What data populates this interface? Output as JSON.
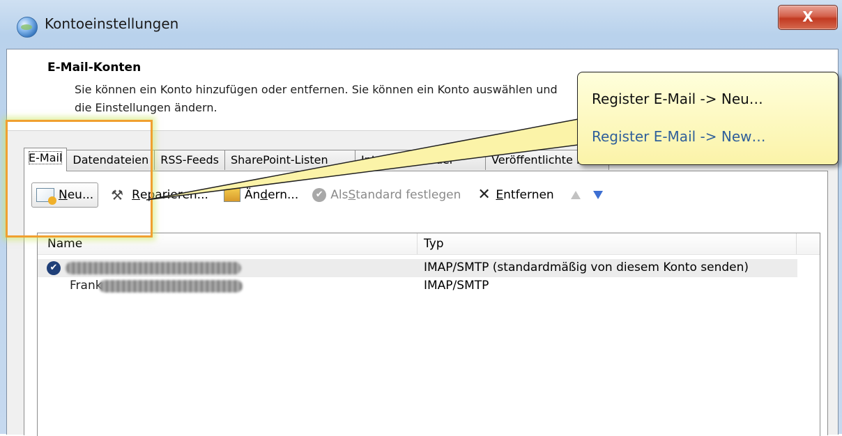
{
  "window": {
    "title": "Kontoeinstellungen",
    "close_glyph": "X"
  },
  "header": {
    "title": "E-Mail-Konten",
    "description": "Sie können ein Konto hinzufügen oder entfernen. Sie können ein Konto auswählen und die Einstellungen ändern."
  },
  "tabs": [
    {
      "label": "E-Mail",
      "active": true
    },
    {
      "label": "Datendateien"
    },
    {
      "label": "RSS-Feeds"
    },
    {
      "label": "SharePoint-Listen"
    },
    {
      "label": "Internetkalender"
    },
    {
      "label": "Veröffentlichte Kalender"
    }
  ],
  "toolbar": {
    "new": {
      "pre": "",
      "mnemonic": "N",
      "post": "eu...",
      "icon": "new-mail-icon"
    },
    "repair": {
      "pre": "",
      "mnemonic": "R",
      "post": "eparieren...",
      "icon": "tools-icon"
    },
    "change": {
      "pre": "Än",
      "mnemonic": "d",
      "post": "ern...",
      "icon": "change-account-icon"
    },
    "set_default": {
      "pre": "Als ",
      "mnemonic": "S",
      "post": "tandard festlegen",
      "icon": "check-circle-icon"
    },
    "remove": {
      "pre": "",
      "mnemonic": "E",
      "post": "ntfernen",
      "icon": "x-icon"
    },
    "move_up_icon": "arrow-up-icon",
    "move_down_icon": "arrow-down-icon"
  },
  "list": {
    "columns": {
      "name": "Name",
      "type": "Typ"
    },
    "rows": [
      {
        "name_visible": "",
        "type": "IMAP/SMTP (standardmäßig von diesem Konto senden)",
        "default": true
      },
      {
        "name_visible": "Frank",
        "type": "IMAP/SMTP",
        "default": false
      }
    ]
  },
  "callout": {
    "line_de": "Register E-Mail -> Neu…",
    "line_en": "Register E-Mail -> New…"
  },
  "colors": {
    "highlight_border": "#f0a030",
    "callout_background": "#fbf3a8",
    "callout_english_text": "#2f5f9a",
    "selected_row": "#ececec"
  }
}
